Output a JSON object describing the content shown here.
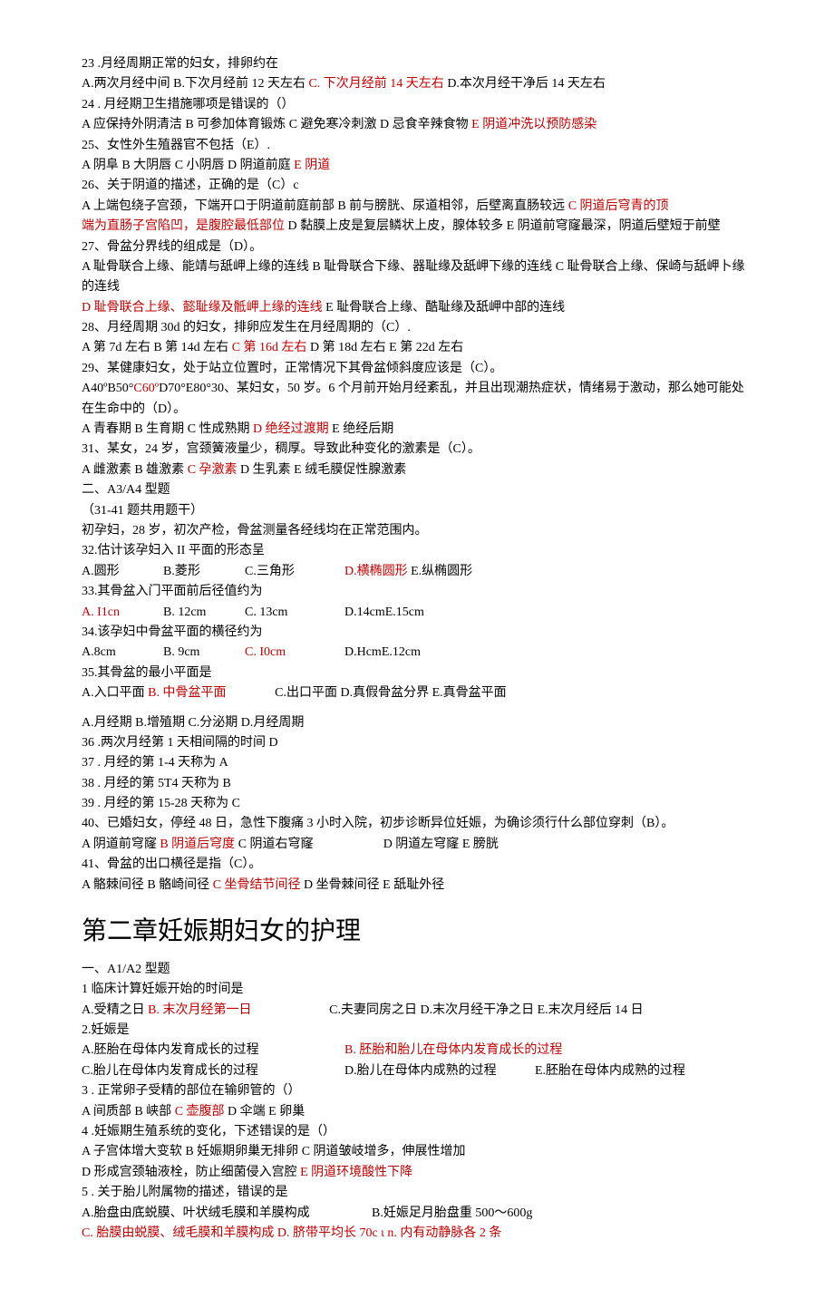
{
  "q23_stem": "23    .月经周期正常的妇女，排卵约在",
  "q23_optA": "A.两次月经中间 ",
  "q23_optB": "B.下次月经前 12 天左右 ",
  "q23_optC": "C. 下次月经前 14 天左右 ",
  "q23_optD": "D.本次月经干净后 14 天左右",
  "q24_stem": "24    . 月经期卫生措施哪项是错误的（）",
  "q24_optA": "A 应保持外阴清洁 ",
  "q24_optB": "B 可参加体育锻炼 ",
  "q24_optC": "C 避免寒冷刺激 ",
  "q24_optD": "D 忌食辛辣食物 ",
  "q24_optE": "E 阴道冲洗以预防感染",
  "q25_stem": "25、女性外生殖器官不包括（E）.",
  "q25_optA": "A 阴阜 ",
  "q25_optB": "B 大阴唇 ",
  "q25_optC": "C 小阴唇 ",
  "q25_optD": "D 阴道前庭 ",
  "q25_optE": "E 阴道",
  "q26_stem": "26、关于阴道的描述，正确的是（C）c",
  "q26_optA": "A 上端包绕子宫颈，下端开口于阴道前庭前部 ",
  "q26_optB": "B 前与膀胱、尿道相邻，后壁离直肠较远 ",
  "q26_optC1": "C 阴道后穹青的顶",
  "q26_optC2": "端为直肠子宫陷凹，是腹腔最低部位 ",
  "q26_optD": "D 黏膜上皮是复层鳞状上皮，腺体较多 ",
  "q26_optE": "E 阴道前穹窿最深，阴道后壁短于前壁",
  "q27_stem": "27、骨盆分界线的组成是（D）。",
  "q27_optA": "A 耻骨联合上缘、能靖与舐岬上缘的连线 ",
  "q27_optB": "B 耻骨联合下缘、器耻缘及舐岬下缘的连线 ",
  "q27_optC": "C 耻骨联合上缘、保崎与舐岬卜缘的连线 ",
  "q27_optD": "D 耻骨联合上缘、懿耻缘及骶岬上缘的连线 ",
  "q27_optE": "E 耻骨联合上缘、酷耻缘及舐岬中部的连线",
  "q28_stem": "28、月经周期 30d 的妇女，排卵应发生在月经周期的（C）.",
  "q28_optA": "A 第 7d 左右 ",
  "q28_optB": "B 第 14d 左右 ",
  "q28_optC": "C 第 16d 左右 ",
  "q28_optD": "D 第 18d 左右 ",
  "q28_optE": "E 第 22d 左右",
  "q29_stem": "29、某健康妇女，处于站立位置时，正常情况下其骨盆倾斜度应该是（C）。",
  "q29_optA": "A40ºB50°",
  "q29_optC": "C60º",
  "q29_optDE": "D70°E80°",
  "q30_stem": "30、某妇女，50 岁。6 个月前开始月经紊乱，并且出现潮热症状，情绪易于激动，那么她可能处在生命中的（D）。",
  "q30_optA": "A 青春期 ",
  "q30_optB": "B 生育期 ",
  "q30_optC": "C 性成熟期 ",
  "q30_optD": "D 绝经过渡期 ",
  "q30_optE": "E 绝经后期",
  "q31_stem": "31、某女，24 岁，宫颈簧液量少，稠厚。导致此种变化的激素是（C）。",
  "q31_optA": "A 雌激素 ",
  "q31_optB": "B 雄激素 ",
  "q31_optC": "C 孕激素 ",
  "q31_optD": "D 生乳素 ",
  "q31_optE": "E 绒毛膜促性腺激素",
  "sec2_title": "二、A3/A4 型题",
  "sec2_range": "（31-41 题共用题干）",
  "case_stem": "初孕妇，28 岁，初次产检，骨盆测量各经线均在正常范围内。",
  "q32_stem": "32.估计该孕妇入 II 平面的形态呈",
  "q32_optA": "A.圆形",
  "q32_optB": "B.菱形",
  "q32_optC": "C.三角形",
  "q32_optD": "D.横椭圆形 ",
  "q32_optE": "E.纵椭圆形",
  "q33_stem": "33.其骨盆入门平面前后径值约为",
  "q33_optA": "A. I1cn",
  "q33_optB": "B. 12cm",
  "q33_optC": "C. 13cm",
  "q33_optDE": "D.14cmE.15cm",
  "q34_stem": "34.该孕妇中骨盆平面的横径约为",
  "q34_optA": "A.8cm",
  "q34_optB": "B. 9cm",
  "q34_optC": "C. I0cm",
  "q34_optDE": "D.HcmE.12cm",
  "q35_stem": "35.其骨盆的最小平面是",
  "q35_optA": "A.入口平面 ",
  "q35_optB": "B. 中骨盆平面",
  "q35_optC": "C.出口平面 ",
  "q35_optD": "D.真假骨盆分界 ",
  "q35_optE": "E.真骨盆平面",
  "shared_opts": "A.月经期 B.增殖期 C.分泌期 D.月经周期",
  "q36": "36    .两次月经第 1 天相间隔的时间 D",
  "q37": "37    . 月经的第 1-4 天称为 A",
  "q38": "38    . 月经的第 5T4 天称为 B",
  "q39": "39    . 月经的第 15-28 天称为 C",
  "q40_stem": "40、已婚妇女，停经 48 日，急性下腹痛 3 小时入院，初步诊断异位妊娠，为确诊须行什么部位穿刺（B）。",
  "q40_optA": "A 阴道前穹窿 ",
  "q40_optB": "B 阴道后穹度 ",
  "q40_optC": "C 阴道右穹窿",
  "q40_optD": "D 阴道左穹窿 ",
  "q40_optE": "E 膀胱",
  "q41_stem": "41、骨盆的出口横径是指（C）。",
  "q41_optA": "A 骼棘间径 ",
  "q41_optB": "B 骼崎间径 ",
  "q41_optC": "C 坐骨结节间径 ",
  "q41_optD": "D 坐骨棘间径 ",
  "q41_optE": "E 舐耻外径",
  "ch2_title": "第二章妊娠期妇女的护理",
  "ch2_sec1": "一、A1/A2 型题",
  "c2q1_stem": "1 临床计算妊娠开始的时间是",
  "c2q1_optA": "A.受精之日 ",
  "c2q1_optB": "B. 末次月经第一日",
  "c2q1_optC": "C.夫妻同房之日 ",
  "c2q1_optD": "D.末次月经干净之日 ",
  "c2q1_optE": "E.末次月经后 14 日",
  "c2q2_stem": "2.妊娠是",
  "c2q2_optA": "A.胚胎在母体内发育成长的过程",
  "c2q2_optB": "B. 胚胎和胎儿在母体内发育成长的过程",
  "c2q2_optC": "C.胎儿在母体内发育成长的过程",
  "c2q2_optD": "D.胎儿在母体内成熟的过程",
  "c2q2_optE": "E.胚胎在母体内成熟的过程",
  "c2q3_stem": "3    . 正常卵子受精的部位在输卵管的（）",
  "c2q3_optA": "A 间质部 ",
  "c2q3_optB": "B 峡部 ",
  "c2q3_optC": "C 壶腹部 ",
  "c2q3_optD": "D 伞端 ",
  "c2q3_optE": "E 卵巢",
  "c2q4_stem": "4    .妊娠期生殖系统的变化，下述错误的是（）",
  "c2q4_optA": "A 子宫体增大变软 ",
  "c2q4_optB": "B 妊娠期卵巢无排卵 ",
  "c2q4_optC": "C 阴道皱岐增多，伸展性增加",
  "c2q4_optD": "D 形成宫颈轴液栓，防止细菌侵入宫腔 ",
  "c2q4_optE": "E 阴道环境酸性下降",
  "c2q5_stem": "5    . 关于胎儿附属物的描述，错误的是",
  "c2q5_optA": "A.胎盘由底蜕膜、叶状绒毛膜和羊膜构成",
  "c2q5_optB": "B.妊娠足月胎盘重 500～600g",
  "c2q5_optC": "C. 胎膜由蜕膜、绒毛膜和羊膜构成 ",
  "c2q5_optD": "D. 脐带平均长 70c ι n. 内有动静脉各 2 条"
}
